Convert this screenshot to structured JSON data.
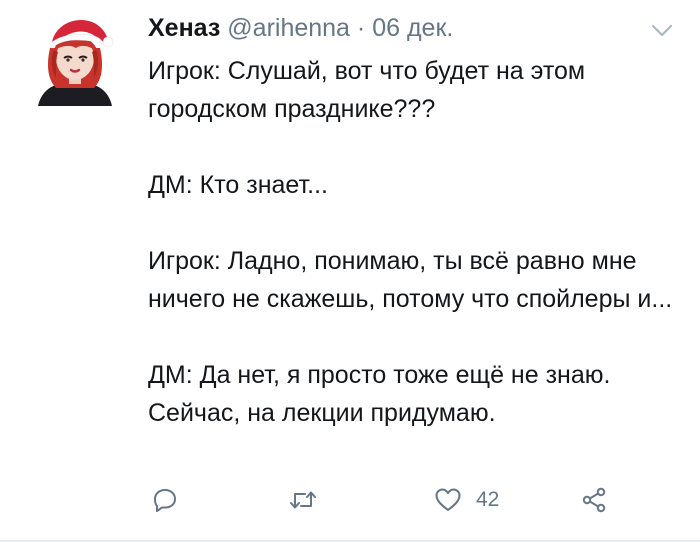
{
  "tweet": {
    "author_name": "Хеназ",
    "handle": "@arihenna",
    "separator": "·",
    "date": "06 дек.",
    "paragraphs": [
      "Игрок: Слушай, вот что будет на этом городском празднике???",
      "ДМ: Кто знает...",
      "Игрок: Ладно, понимаю, ты всё равно мне ничего не скажешь, потому что спойлеры и...",
      "ДМ: Да нет, я просто тоже ещё не знаю. Сейчас, на лекции придумаю."
    ]
  },
  "actions": {
    "reply_icon": "reply-icon",
    "retweet_icon": "retweet-icon",
    "like_icon": "heart-icon",
    "like_count": "42",
    "share_icon": "share-icon"
  },
  "colors": {
    "text": "#14171a",
    "muted": "#657786",
    "divider": "#e6ecf0",
    "santa_hat": "#d6263a",
    "hair": "#c8332b"
  }
}
